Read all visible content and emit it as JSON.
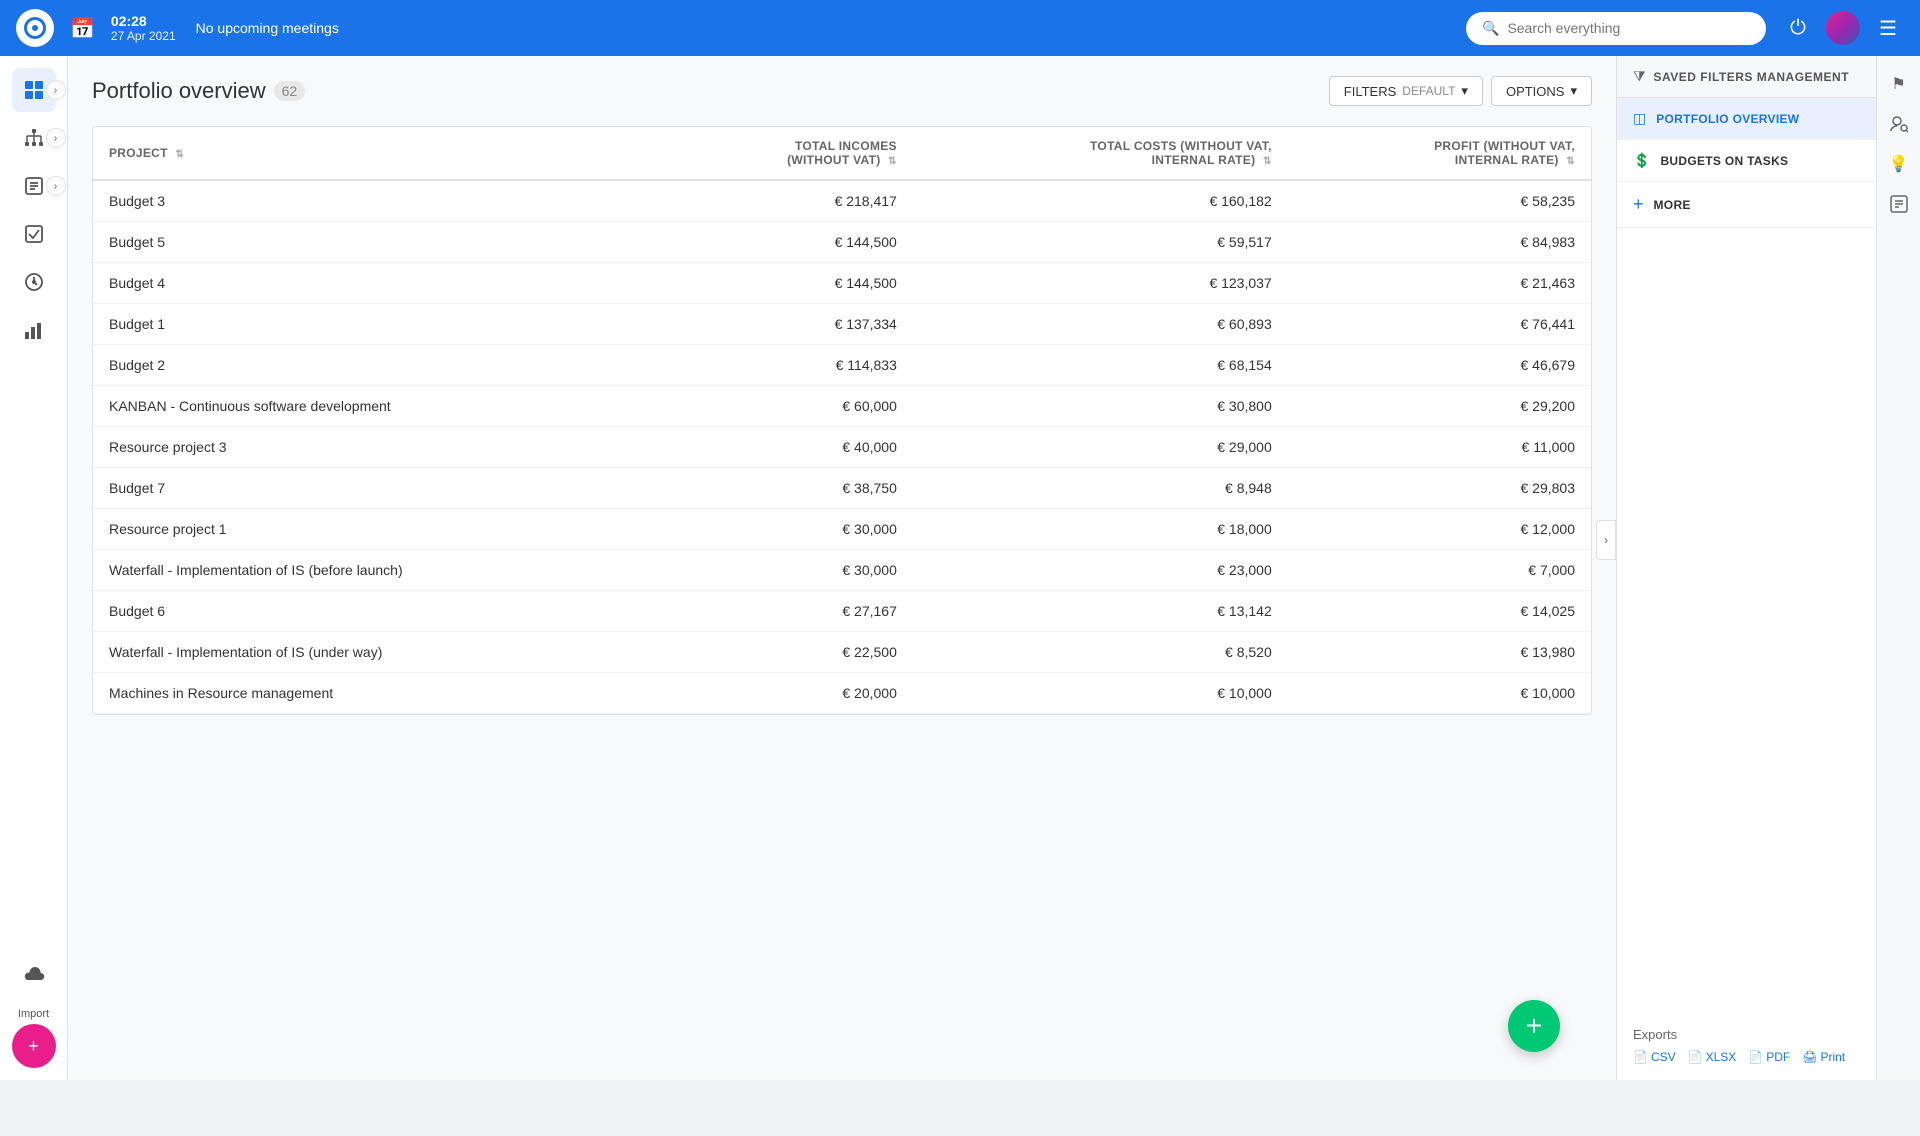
{
  "topnav": {
    "time": "02:28",
    "date": "27 Apr 2021",
    "meeting_status": "No upcoming meetings",
    "search_placeholder": "Search everything"
  },
  "page": {
    "title": "Portfolio overview",
    "count": "62",
    "filters_label": "FILTERS",
    "filters_value": "DEFAULT",
    "options_label": "OPTIONS"
  },
  "table": {
    "columns": [
      {
        "key": "project",
        "label": "PROJECT",
        "align": "left"
      },
      {
        "key": "total_incomes",
        "label": "TOTAL INCOMES (WITHOUT VAT)",
        "align": "right"
      },
      {
        "key": "total_costs",
        "label": "TOTAL COSTS (WITHOUT VAT, INTERNAL RATE)",
        "align": "right"
      },
      {
        "key": "profit",
        "label": "PROFIT (WITHOUT VAT, INTERNAL RATE)",
        "align": "right"
      }
    ],
    "rows": [
      {
        "project": "Budget 3",
        "total_incomes": "€ 218,417",
        "total_costs": "€ 160,182",
        "profit": "€ 58,235"
      },
      {
        "project": "Budget 5",
        "total_incomes": "€ 144,500",
        "total_costs": "€ 59,517",
        "profit": "€ 84,983"
      },
      {
        "project": "Budget 4",
        "total_incomes": "€ 144,500",
        "total_costs": "€ 123,037",
        "profit": "€ 21,463"
      },
      {
        "project": "Budget 1",
        "total_incomes": "€ 137,334",
        "total_costs": "€ 60,893",
        "profit": "€ 76,441"
      },
      {
        "project": "Budget 2",
        "total_incomes": "€ 114,833",
        "total_costs": "€ 68,154",
        "profit": "€ 46,679"
      },
      {
        "project": "KANBAN - Continuous software development",
        "total_incomes": "€ 60,000",
        "total_costs": "€ 30,800",
        "profit": "€ 29,200"
      },
      {
        "project": "Resource project 3",
        "total_incomes": "€ 40,000",
        "total_costs": "€ 29,000",
        "profit": "€ 11,000"
      },
      {
        "project": "Budget 7",
        "total_incomes": "€ 38,750",
        "total_costs": "€ 8,948",
        "profit": "€ 29,803"
      },
      {
        "project": "Resource project 1",
        "total_incomes": "€ 30,000",
        "total_costs": "€ 18,000",
        "profit": "€ 12,000"
      },
      {
        "project": "Waterfall - Implementation of IS (before launch)",
        "total_incomes": "€ 30,000",
        "total_costs": "€ 23,000",
        "profit": "€ 7,000"
      },
      {
        "project": "Budget 6",
        "total_incomes": "€ 27,167",
        "total_costs": "€ 13,142",
        "profit": "€ 14,025"
      },
      {
        "project": "Waterfall - Implementation of IS (under way)",
        "total_incomes": "€ 22,500",
        "total_costs": "€ 8,520",
        "profit": "€ 13,980"
      },
      {
        "project": "Machines in Resource management",
        "total_incomes": "€ 20,000",
        "total_costs": "€ 10,000",
        "profit": "€ 10,000"
      }
    ]
  },
  "side_menu": {
    "header": "SAVED FILTERS MANAGEMENT",
    "items": [
      {
        "label": "PORTFOLIO OVERVIEW",
        "active": true
      },
      {
        "label": "BUDGETS ON TASKS",
        "active": false
      },
      {
        "label": "MORE",
        "active": false,
        "add": true
      }
    ],
    "exports": {
      "title": "Exports",
      "links": [
        "CSV",
        "XLSX",
        "PDF",
        "Print"
      ]
    }
  },
  "sidebar": {
    "items": [
      {
        "icon": "grid",
        "name": "dashboard"
      },
      {
        "icon": "sitemap",
        "name": "hierarchy"
      },
      {
        "icon": "clipboard",
        "name": "tasks"
      },
      {
        "icon": "check-circle",
        "name": "approvals"
      },
      {
        "icon": "clock-circle",
        "name": "time"
      },
      {
        "icon": "bar-chart",
        "name": "reports"
      },
      {
        "icon": "cloud",
        "name": "cloud"
      }
    ],
    "import_label": "Import"
  },
  "fab": {
    "label": "+"
  }
}
